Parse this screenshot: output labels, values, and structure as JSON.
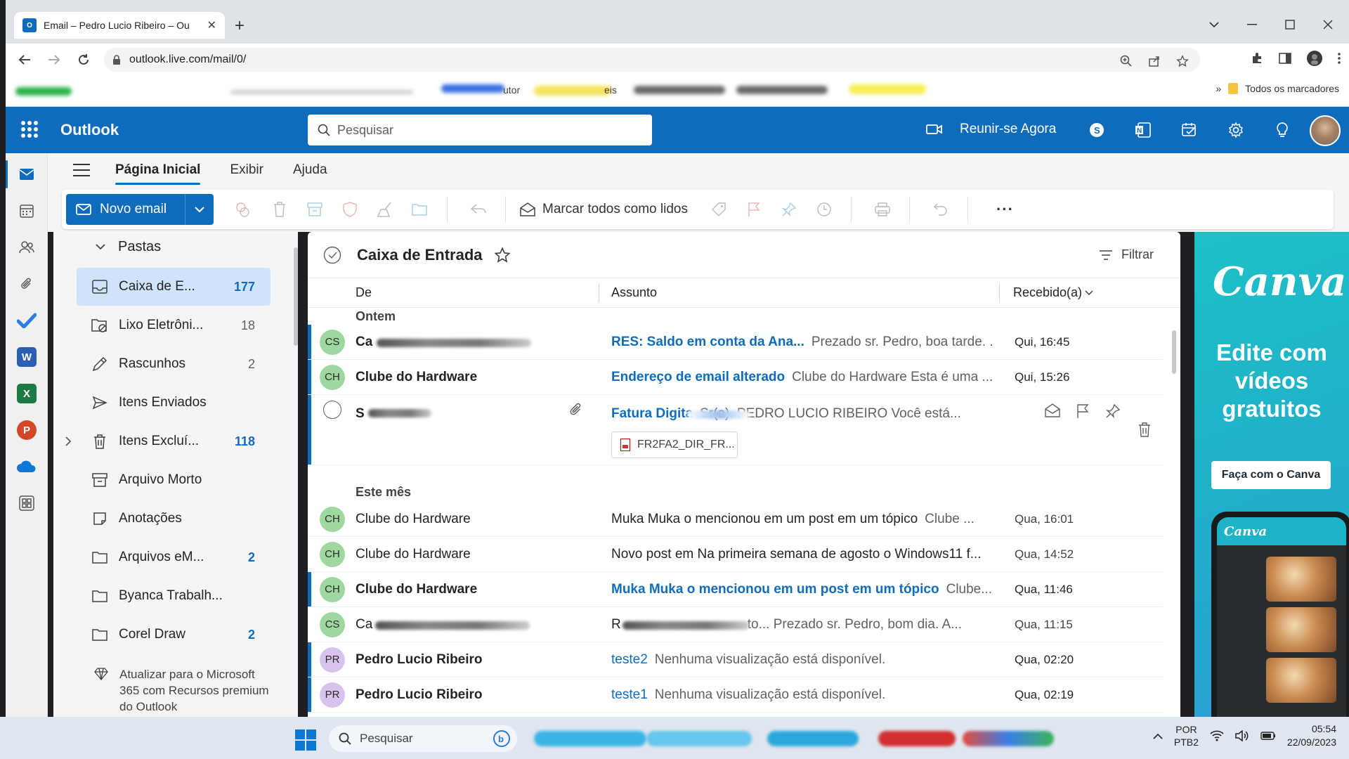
{
  "browser": {
    "tab_title": "Email – Pedro Lucio Ribeiro – Ou",
    "url": "outlook.live.com/mail/0/",
    "bookmarks": [
      "utor",
      "eis"
    ],
    "all_bookmarks": "Todos os marcadores"
  },
  "header": {
    "app_name": "Outlook",
    "search_placeholder": "Pesquisar",
    "meet_now": "Reunir-se Agora"
  },
  "ribbon": {
    "tabs": [
      "Página Inicial",
      "Exibir",
      "Ajuda"
    ],
    "new_mail": "Novo email",
    "mark_all_read": "Marcar todos como lidos",
    "more": "···"
  },
  "folders": {
    "section": "Pastas",
    "items": [
      {
        "name": "Caixa de E...",
        "count": "177",
        "icon": "inbox-icon",
        "selected": true
      },
      {
        "name": "Lixo Eletrôni...",
        "count": "18",
        "icon": "junk-icon"
      },
      {
        "name": "Rascunhos",
        "count": "2",
        "icon": "draft-icon"
      },
      {
        "name": "Itens Enviados",
        "count": "",
        "icon": "send-icon"
      },
      {
        "name": "Itens Excluí...",
        "count": "118",
        "icon": "trash-icon"
      },
      {
        "name": "Arquivo Morto",
        "count": "",
        "icon": "archive-icon"
      },
      {
        "name": "Anotações",
        "count": "",
        "icon": "note-icon"
      },
      {
        "name": "Arquivos eM...",
        "count": "2",
        "icon": "folder-icon"
      },
      {
        "name": "Byanca Trabalh...",
        "count": "",
        "icon": "folder-icon"
      },
      {
        "name": "Corel Draw",
        "count": "2",
        "icon": "folder-icon"
      }
    ],
    "upgrade_text": "Atualizar para o Microsoft 365 com Recursos premium do Outlook"
  },
  "message_list": {
    "title": "Caixa de Entrada",
    "filter": "Filtrar",
    "columns": {
      "from": "De",
      "subject": "Assunto",
      "received": "Recebido(a)"
    },
    "groups": [
      "Ontem",
      "Este mês"
    ],
    "messages": [
      {
        "initials": "CS",
        "sender": "Ca",
        "subject": "RES: Saldo em conta da Ana...",
        "preview": "Prezado sr. Pedro, boa tarde. ...",
        "time": "Qui, 16:45"
      },
      {
        "initials": "CH",
        "sender": "Clube do Hardware",
        "subject": "Endereço de email alterado",
        "preview": "Clube do Hardware Esta é uma ...",
        "time": "Qui, 15:26"
      },
      {
        "initials": "",
        "sender": "S",
        "subject": "Fatura Digita",
        "preview": "Sr(a). PEDRO LUCIO RIBEIRO Você está...",
        "attachment": "FR2FA2_DIR_FR...",
        "time": ""
      },
      {
        "initials": "CH",
        "sender": "Clube do Hardware",
        "subject": "Muka Muka o mencionou em um post em um tópico",
        "preview": "Clube ...",
        "time": "Qua, 16:01"
      },
      {
        "initials": "CH",
        "sender": "Clube do Hardware",
        "subject": "Novo post em Na primeira semana de agosto o Windows11 f...",
        "preview": "",
        "time": "Qua, 14:52"
      },
      {
        "initials": "CH",
        "sender": "Clube do Hardware",
        "subject": "Muka Muka o mencionou em um post em um tópico",
        "preview": "Clube...",
        "time": "Qua, 11:46"
      },
      {
        "initials": "CS",
        "sender": "Ca",
        "subject": "R",
        "preview": "to...  Prezado sr. Pedro, bom dia. A...",
        "time": "Qua, 11:15"
      },
      {
        "initials": "PR",
        "sender": "Pedro Lucio Ribeiro",
        "subject": "teste2",
        "preview": "Nenhuma visualização está disponível.",
        "time": "Qua, 02:20"
      },
      {
        "initials": "PR",
        "sender": "Pedro Lucio Ribeiro",
        "subject": "teste1",
        "preview": "Nenhuma visualização está disponível.",
        "time": "Qua, 02:19"
      }
    ]
  },
  "ad": {
    "brand": "Canva",
    "headline": "Edite com vídeos gratuitos",
    "cta": "Faça com o Canva",
    "phone_brand": "Canva"
  },
  "taskbar": {
    "search": "Pesquisar",
    "lang_top": "POR",
    "lang_bottom": "PTB2",
    "time": "05:54",
    "date": "22/09/2023"
  },
  "colors": {
    "brand_blue": "#0f6cbd",
    "selected_folder": "#cfe4fa",
    "avatar_green": "#9fd89f",
    "avatar_purple": "#d8c3ee"
  }
}
